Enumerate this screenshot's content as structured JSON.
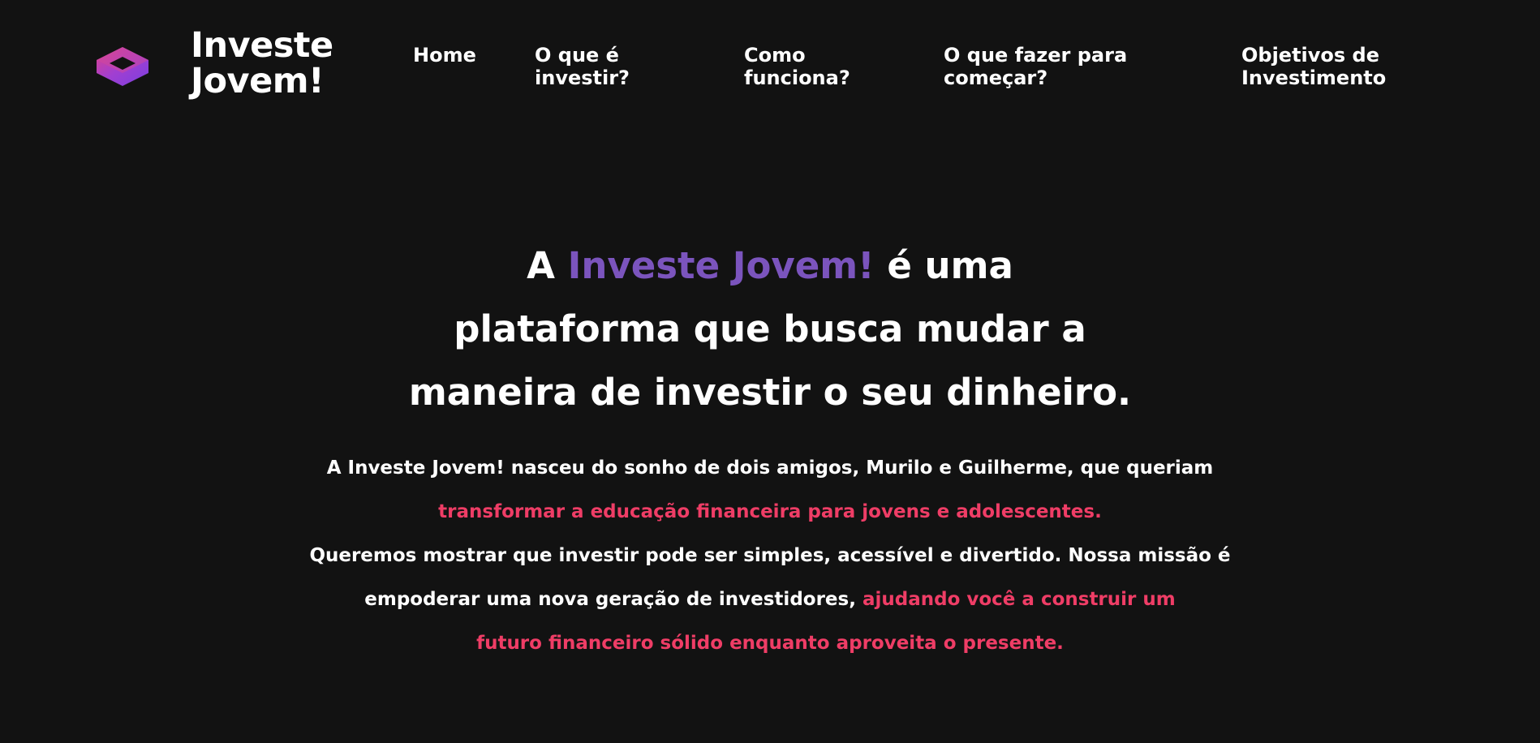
{
  "colors": {
    "background": "#121212",
    "text": "#ffffff",
    "accent_purple": "#7b54bd",
    "accent_pink": "#ef3d66"
  },
  "brand": {
    "logo_icon": "hexagon-cube-icon",
    "line1": "Investe",
    "line2": "Jovem!"
  },
  "nav": {
    "items": [
      {
        "line1": "Home",
        "line2": ""
      },
      {
        "line1": "O que é",
        "line2": "investir?"
      },
      {
        "line1": "Como",
        "line2": "funciona?"
      },
      {
        "line1": "O que fazer para",
        "line2": "começar?"
      },
      {
        "line1": "Objetivos de",
        "line2": "Investimento"
      }
    ]
  },
  "hero": {
    "title_prefix": "A ",
    "title_accent": "Investe Jovem!",
    "title_line1_rest": " é uma",
    "title_line2": "plataforma que busca mudar a",
    "title_line3": "maneira de investir o seu dinheiro.",
    "p1": "A Investe Jovem! nasceu do sonho de dois amigos, Murilo e Guilherme, que queriam",
    "p1_highlight": "transformar a educação financeira para jovens e adolescentes.",
    "p2": "Queremos mostrar que investir pode ser simples, acessível e divertido. Nossa missão é",
    "p3": "empoderar uma nova geração de investidores, ",
    "p3_highlight": "ajudando você a construir um",
    "p4_highlight": "futuro financeiro sólido enquanto aproveita o presente."
  }
}
